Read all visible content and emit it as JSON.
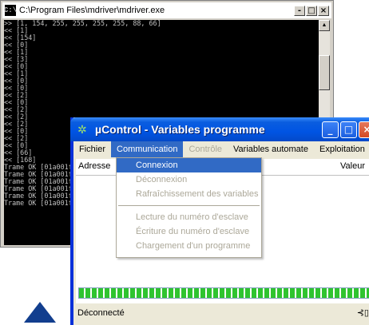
{
  "console": {
    "title": "C:\\Program Files\\mdriver\\mdriver.exe",
    "icon_label": "C:\\",
    "lines": [
      ">> [1, 154, 255, 255, 255, 255, 88, 66]",
      "<< [1]",
      "<< [154]",
      "<< [0]",
      "<< [1]",
      "<< [3]",
      "<< [0]",
      "<< [1]",
      "<< [0]",
      "<< [0]",
      "<< [2]",
      "<< [0]",
      "<< [2]",
      "<< [2]",
      "<< [2]",
      "<< [0]",
      "<< [2]",
      "<< [0]",
      "<< [66]",
      "<< [168]",
      "Trame OK [01a001fc",
      "Trame OK [01a001fc",
      "Trame OK [01a001fc",
      "Trame OK [01a001fc",
      "Trame OK [01a001fc",
      "Trame OK [01a001fc"
    ],
    "buttons": {
      "minimize": "-",
      "maximize": "□",
      "close": "×"
    }
  },
  "app": {
    "title": "µControl - Variables programme",
    "icon": "gear-icon",
    "menu": [
      {
        "label": "Fichier",
        "state": "normal"
      },
      {
        "label": "Communication",
        "state": "active"
      },
      {
        "label": "Contrôle",
        "state": "disabled"
      },
      {
        "label": "Variables automate",
        "state": "normal"
      },
      {
        "label": "Exploitation",
        "state": "normal"
      }
    ],
    "columns": {
      "address": "Adresse",
      "value": "Valeur"
    },
    "status": "Déconnecté",
    "progress": 1.0,
    "status_icon": "connector-icon",
    "buttons": {
      "minimize": "_",
      "maximize": "□",
      "close": "×"
    }
  },
  "dropdown": {
    "items": [
      {
        "label": "Connexion",
        "state": "highlight"
      },
      {
        "label": "Déconnexion",
        "state": "disabled"
      },
      {
        "label": "Rafraîchissement des variables",
        "state": "disabled"
      },
      {
        "label": "Lecture du numéro d'esclave",
        "state": "disabled"
      },
      {
        "label": "Écriture du numéro d'esclave",
        "state": "disabled"
      },
      {
        "label": "Chargement d'un programme",
        "state": "disabled"
      }
    ]
  },
  "colors": {
    "xp_title_blue": "#0054e3",
    "menu_highlight": "#316ac5",
    "progress_green": "#2fc42f",
    "triangle": "#123e8e"
  }
}
